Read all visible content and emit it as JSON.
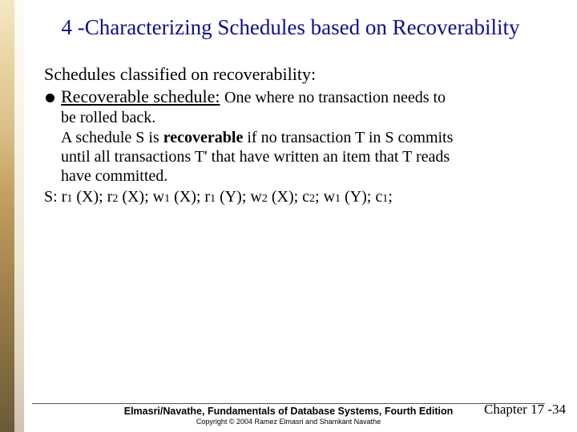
{
  "title": "4 -Characterizing Schedules based on Recoverability",
  "intro": "Schedules classified on recoverability:",
  "bullet": {
    "term": "Recoverable schedule:",
    "desc": "One where no transaction needs to"
  },
  "continuation": {
    "line1": "be rolled back.",
    "line2_a": "A schedule S is ",
    "line2_b": "recoverable",
    "line2_c": " if no transaction T in S commits",
    "line3": "until all transactions T' that have written an item that T reads",
    "line4": "have committed."
  },
  "schedule": {
    "prefix": "S: r",
    "parts": [
      {
        "sub": "1",
        "after": " (X); r"
      },
      {
        "sub": "2",
        "after": " (X); w"
      },
      {
        "sub": "1",
        "after": " (X); r"
      },
      {
        "sub": "1",
        "after": " (Y); w"
      },
      {
        "sub": "2",
        "after": " (X); c"
      },
      {
        "sub": "2",
        "after": "; w"
      },
      {
        "sub": "1",
        "after": " (Y); c"
      },
      {
        "sub": "1",
        "after": ";"
      }
    ]
  },
  "footer": {
    "main": "Elmasri/Navathe, Fundamentals of Database Systems, Fourth Edition",
    "copy": "Copyright © 2004 Ramez Elmasri and Shamkant Navathe"
  },
  "chapter": "Chapter 17 -34"
}
